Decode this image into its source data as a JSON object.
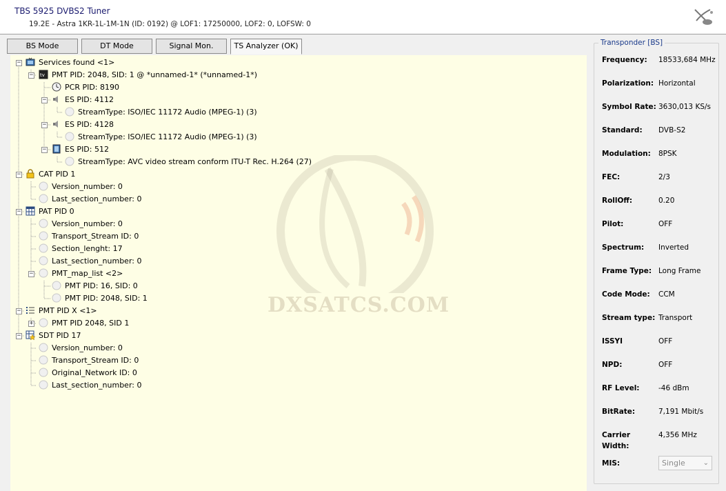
{
  "header": {
    "title": "TBS 5925 DVBS2 Tuner",
    "subtitle": "19.2E - Astra 1KR-1L-1M-1N (ID: 0192) @ LOF1: 17250000, LOF2: 0, LOFSW: 0"
  },
  "tabs": [
    {
      "label": "BS Mode"
    },
    {
      "label": "DT Mode"
    },
    {
      "label": "Signal Mon."
    },
    {
      "label": "TS Analyzer (OK)",
      "active": true
    }
  ],
  "tree": [
    {
      "label": "Services found <1>",
      "icon": "tv-folder-icon",
      "expander": "minus"
    },
    {
      "label": "PMT PID: 2048, SID: 1 @ *unnamed-1* (*unnamed-1*)",
      "icon": "tv-icon",
      "expander": "minus"
    },
    {
      "label": "PCR PID: 8190",
      "icon": "clock-icon"
    },
    {
      "label": "ES PID: 4112",
      "icon": "speaker-icon",
      "expander": "minus"
    },
    {
      "label": "StreamType: ISO/IEC 11172 Audio (MPEG-1) (3)",
      "icon": "circle-icon"
    },
    {
      "label": "ES PID: 4128",
      "icon": "speaker-icon",
      "expander": "minus"
    },
    {
      "label": "StreamType: ISO/IEC 11172 Audio (MPEG-1) (3)",
      "icon": "circle-icon"
    },
    {
      "label": "ES PID: 512",
      "icon": "film-icon",
      "expander": "minus"
    },
    {
      "label": "StreamType: AVC video stream conform ITU-T Rec. H.264 (27)",
      "icon": "circle-icon"
    },
    {
      "label": "CAT PID 1",
      "icon": "lock-icon",
      "expander": "minus"
    },
    {
      "label": "Version_number: 0",
      "icon": "circle-icon"
    },
    {
      "label": "Last_section_number: 0",
      "icon": "circle-icon"
    },
    {
      "label": "PAT PID 0",
      "icon": "table-icon",
      "expander": "minus"
    },
    {
      "label": "Version_number: 0",
      "icon": "circle-icon"
    },
    {
      "label": "Transport_Stream ID: 0",
      "icon": "circle-icon"
    },
    {
      "label": "Section_lenght: 17",
      "icon": "circle-icon"
    },
    {
      "label": "Last_section_number: 0",
      "icon": "circle-icon"
    },
    {
      "label": "PMT_map_list <2>",
      "icon": "circle-icon",
      "expander": "minus"
    },
    {
      "label": "PMT PID: 16, SID: 0",
      "icon": "circle-icon"
    },
    {
      "label": "PMT PID: 2048, SID: 1",
      "icon": "circle-icon"
    },
    {
      "label": "PMT PID X <1>",
      "icon": "list-icon",
      "expander": "minus"
    },
    {
      "label": "PMT PID 2048, SID 1",
      "icon": "circle-icon",
      "expander": "plus"
    },
    {
      "label": "SDT PID 17",
      "icon": "star-table-icon",
      "expander": "minus"
    },
    {
      "label": "Version_number: 0",
      "icon": "circle-icon"
    },
    {
      "label": "Transport_Stream ID: 0",
      "icon": "circle-icon"
    },
    {
      "label": "Original_Network ID: 0",
      "icon": "circle-icon"
    },
    {
      "label": "Last_section_number: 0",
      "icon": "circle-icon"
    }
  ],
  "watermark": "DXSATCS.COM",
  "transponder": {
    "title": "Transponder [BS]",
    "properties": [
      {
        "label": "Frequency:",
        "value": "18533,684 MHz"
      },
      {
        "label": "Polarization:",
        "value": "Horizontal"
      },
      {
        "label": "Symbol Rate:",
        "value": "3630,013 KS/s"
      },
      {
        "label": "Standard:",
        "value": "DVB-S2"
      },
      {
        "label": "Modulation:",
        "value": "8PSK"
      },
      {
        "label": "FEC:",
        "value": "2/3"
      },
      {
        "label": "RollOff:",
        "value": "0.20"
      },
      {
        "label": "Pilot:",
        "value": "OFF"
      },
      {
        "label": "Spectrum:",
        "value": "Inverted"
      },
      {
        "label": "Frame Type:",
        "value": "Long Frame"
      },
      {
        "label": "Code Mode:",
        "value": "CCM"
      },
      {
        "label": "Stream type:",
        "value": "Transport"
      },
      {
        "label": "ISSYI",
        "value": "OFF"
      },
      {
        "label": "NPD:",
        "value": "OFF"
      },
      {
        "label": "RF Level:",
        "value": "-46 dBm"
      },
      {
        "label": "BitRate:",
        "value": "7,191 Mbit/s"
      },
      {
        "label": "Carrier Width:",
        "value": "4,356 MHz"
      }
    ],
    "mis_label": "MIS:",
    "mis_value": "Single"
  }
}
